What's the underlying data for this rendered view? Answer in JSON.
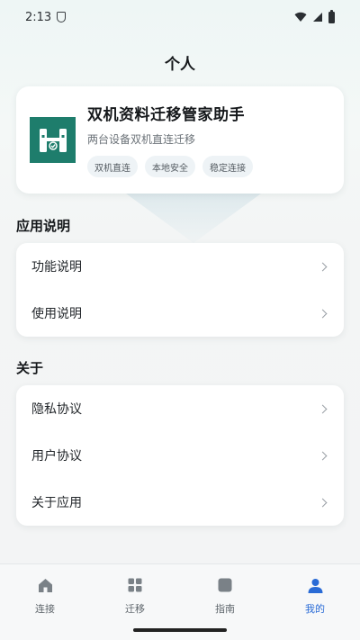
{
  "status_bar": {
    "time": "2:13"
  },
  "page": {
    "title": "个人"
  },
  "app": {
    "name": "双机资料迁移管家助手",
    "description": "两台设备双机直连迁移",
    "tags": [
      "双机直连",
      "本地安全",
      "稳定连接"
    ],
    "logo_color": "#1e7d6c"
  },
  "sections": [
    {
      "title": "应用说明",
      "items": [
        "功能说明",
        "使用说明"
      ]
    },
    {
      "title": "关于",
      "items": [
        "隐私协议",
        "用户协议",
        "关于应用"
      ]
    }
  ],
  "bottom_nav": {
    "items": [
      {
        "label": "连接",
        "icon": "home-icon",
        "active": false
      },
      {
        "label": "迁移",
        "icon": "grid-icon",
        "active": false
      },
      {
        "label": "指南",
        "icon": "square-icon",
        "active": false
      },
      {
        "label": "我的",
        "icon": "person-icon",
        "active": true
      }
    ],
    "active_color": "#2a6bd6"
  }
}
